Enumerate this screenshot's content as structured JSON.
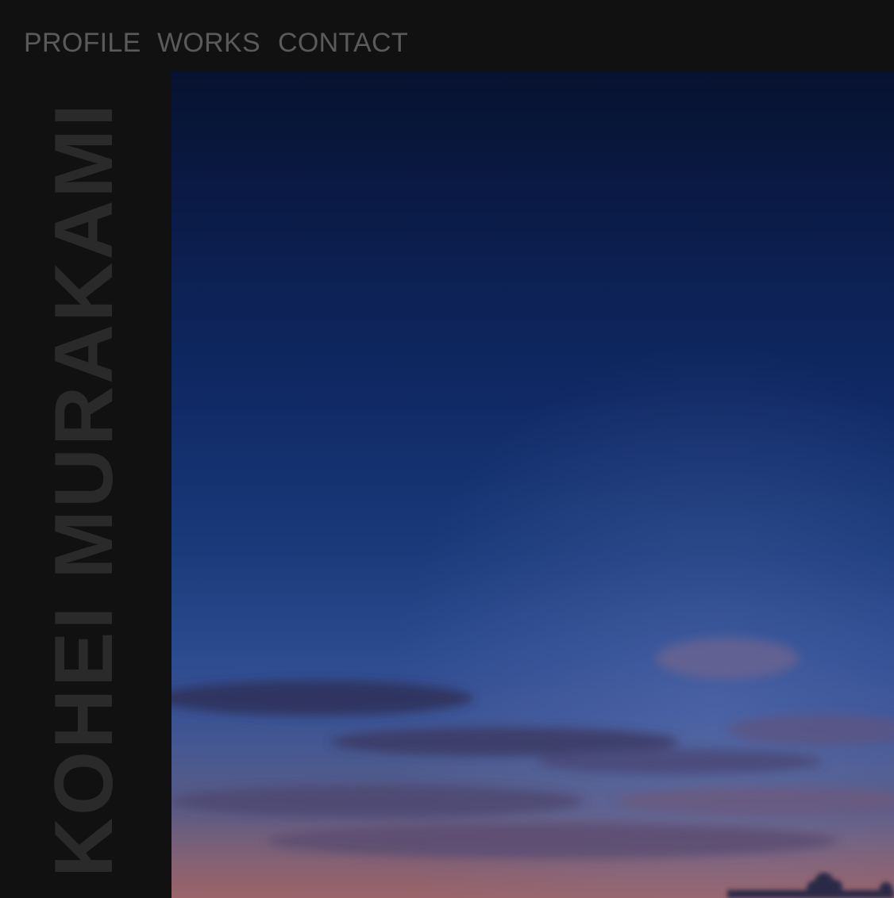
{
  "nav": {
    "profile_label": "PROFILE",
    "works_label": "WORKS",
    "contact_label": "CONTACT"
  },
  "sidebar": {
    "site_name": "KOHEI MURAKAMI"
  },
  "hero": {
    "scene": "twilight-sky-photo"
  },
  "colors": {
    "background": "#111111",
    "nav_text": "#5a5a5a",
    "site_name_text": "#2a2a2a",
    "sky_top": "#07122f",
    "sky_bottom": "#835d70"
  }
}
